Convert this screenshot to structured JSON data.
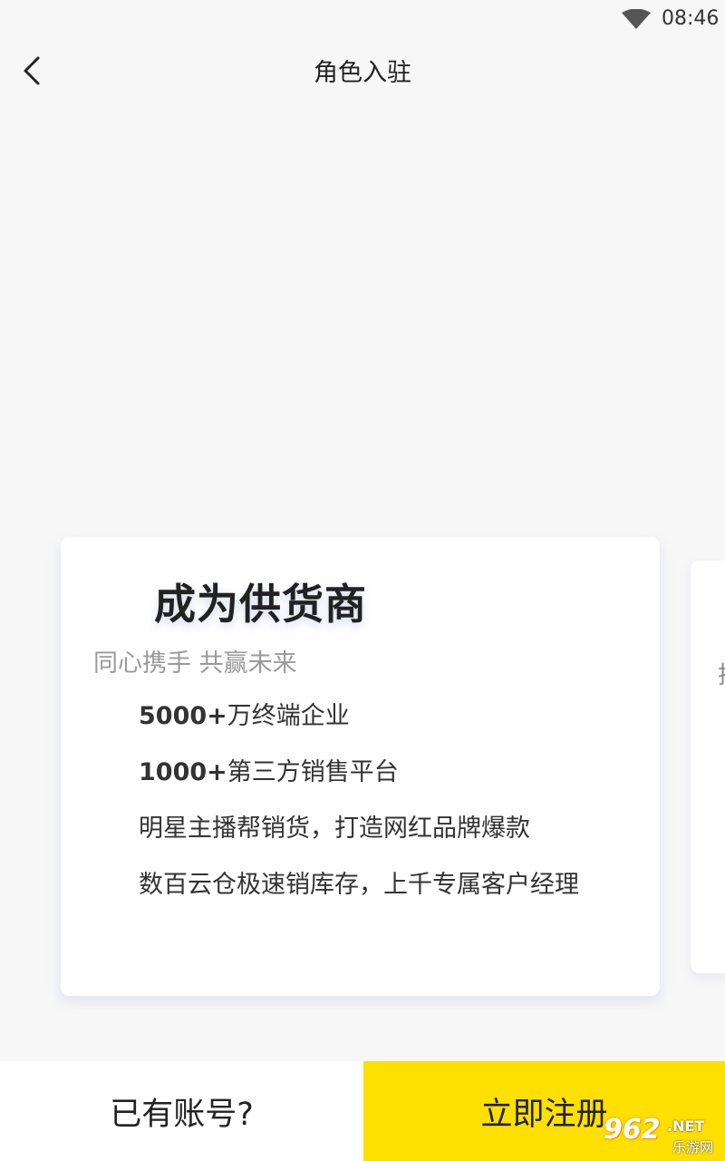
{
  "status_bar": {
    "time": "08:46",
    "wifi_icon": "wifi-icon"
  },
  "header": {
    "back_icon": "back-arrow-icon",
    "title": "角色入驻"
  },
  "card": {
    "title": "成为供货商",
    "subtitle": "同心携手 共赢未来",
    "features": [
      {
        "bold": "5000+",
        "text": "万终端企业"
      },
      {
        "bold": "1000+",
        "text": "第三方销售平台"
      },
      {
        "bold": "",
        "text": "明星主播帮销货，打造网红品牌爆款"
      },
      {
        "bold": "",
        "text": "数百云仓极速销库存，上千专属客户经理"
      }
    ]
  },
  "next_card": {
    "peek_text": "拮"
  },
  "bottom": {
    "login_label": "已有账号?",
    "register_label": "立即注册"
  },
  "watermark": {
    "main": "962",
    "net": ".NET",
    "sub": "乐游网"
  },
  "colors": {
    "accent": "#fddf00",
    "background": "#f7f7f7"
  }
}
